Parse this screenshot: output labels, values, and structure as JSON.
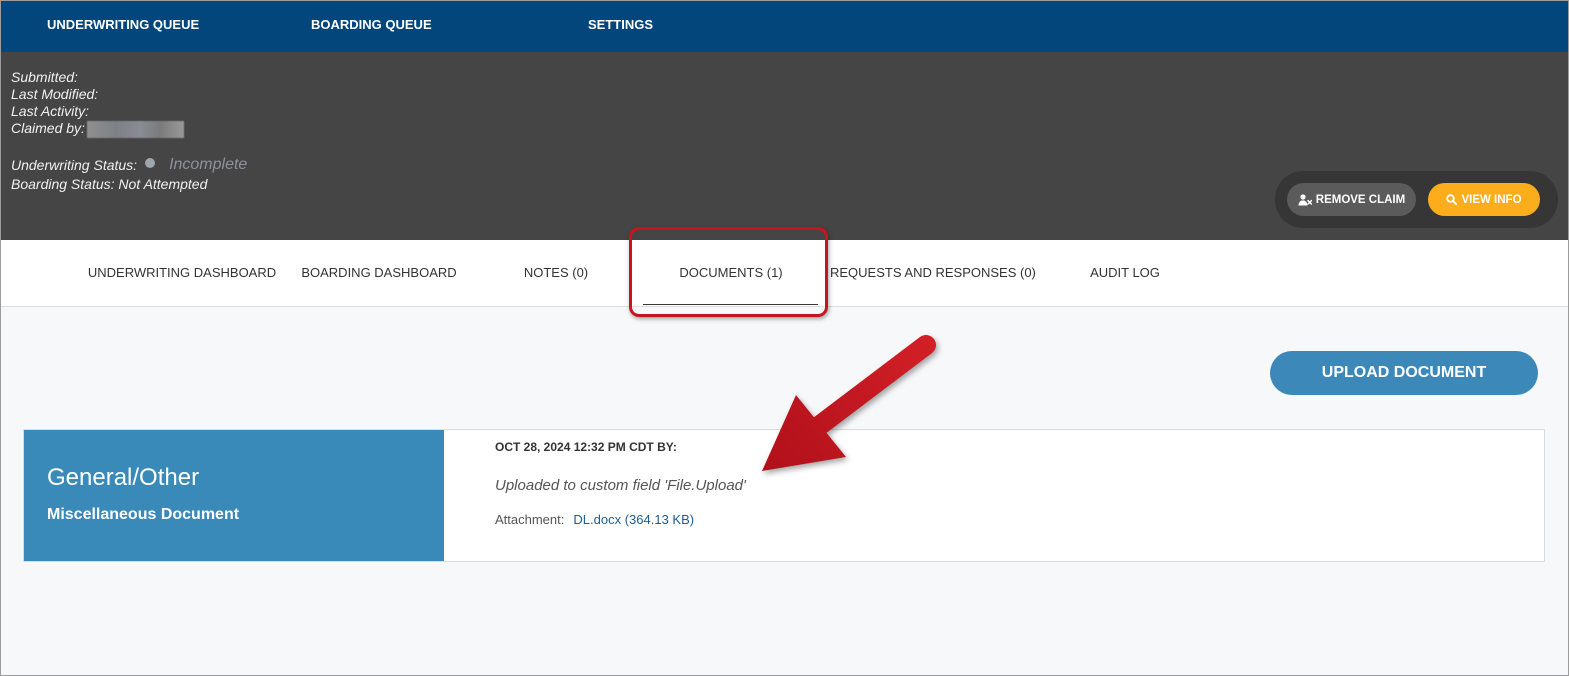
{
  "app": {
    "nav": [
      {
        "label": "UNDERWRITING QUEUE"
      },
      {
        "label": "BOARDING QUEUE"
      },
      {
        "label": "SETTINGS"
      }
    ]
  },
  "summary": {
    "submitted_label": "Submitted:",
    "last_modified_label": "Last Modified:",
    "last_activity_label": "Last Activity:",
    "claimed_by_label": "Claimed by:",
    "underwriting_status_label": "Underwriting Status:",
    "underwriting_status_value": "Incomplete",
    "boarding_status_label": "Boarding Status:",
    "boarding_status_value": "Not Attempted"
  },
  "claim_actions": {
    "remove_claim": {
      "label": "REMOVE CLAIM",
      "icon": "user-x-icon"
    },
    "view_info": {
      "label": "VIEW INFO",
      "icon": "search-icon"
    }
  },
  "tabs": [
    {
      "label": "UNDERWRITING DASHBOARD",
      "active": false
    },
    {
      "label": "BOARDING DASHBOARD",
      "active": false
    },
    {
      "label": "NOTES (0)",
      "active": false
    },
    {
      "label": "DOCUMENTS (1)",
      "active": true
    },
    {
      "label": "REQUESTS AND RESPONSES (0)",
      "active": false
    },
    {
      "label": "AUDIT LOG",
      "active": false
    }
  ],
  "documents": {
    "upload_button_label": "UPLOAD DOCUMENT",
    "items": [
      {
        "category": "General/Other",
        "document_type": "Miscellaneous Document",
        "uploaded_at": "OCT 28, 2024 12:32 PM CDT BY:",
        "description": "Uploaded to custom field 'File.Upload'",
        "attachment_label": "Attachment:",
        "attachment_name": "DL.docx",
        "attachment_size": "(364.13 KB)"
      }
    ]
  },
  "colors": {
    "nav_bg": "#03467c",
    "header_bg": "#454545",
    "accent_blue": "#3a8ab9",
    "view_info_amber": "#fbad1b",
    "status_incomplete": "#a0a4ab",
    "link": "#1c5c96",
    "annotation_red": "#c8141e"
  },
  "icons": {
    "status_indicator": "status-dot-icon"
  }
}
